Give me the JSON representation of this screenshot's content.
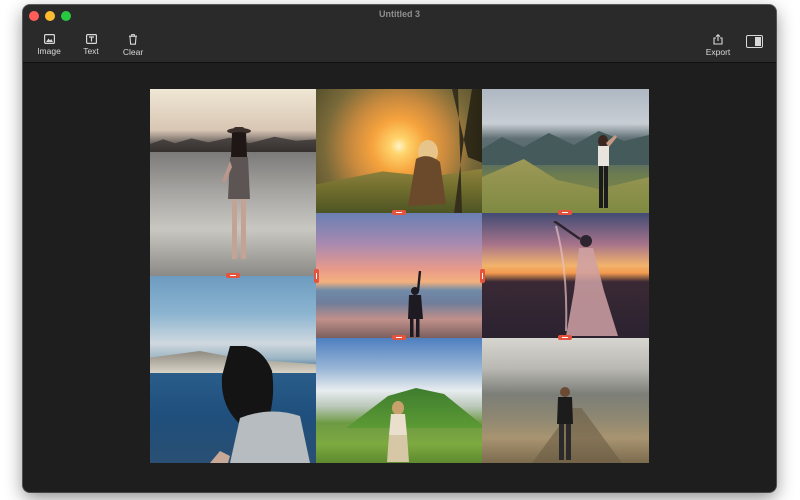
{
  "window": {
    "title": "Untitled 3"
  },
  "toolbar": {
    "image_label": "Image",
    "text_label": "Text",
    "clear_label": "Clear",
    "export_label": "Export"
  },
  "colors": {
    "window_bg": "#1e1e1e",
    "toolbar_bg": "#2a2a2a",
    "handle": "#e5533c",
    "close": "#ff5f57",
    "minimize": "#febc2e",
    "zoom": "#28c840"
  },
  "collage": {
    "photos": [
      "beach-sunset-girl-hat",
      "golden-sunset-field",
      "mountain-view-girl",
      "pink-sunset-beach",
      "dusk-field-dress",
      "sea-view-dark-hair",
      "green-hill-girl",
      "foggy-path-girl"
    ]
  }
}
